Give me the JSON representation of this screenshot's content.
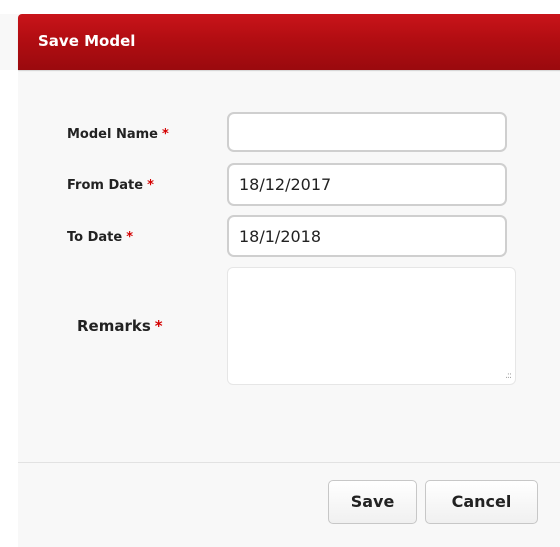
{
  "dialog": {
    "title": "Save Model"
  },
  "form": {
    "model_name": {
      "label": "Model Name",
      "required_marker": "*",
      "value": ""
    },
    "from_date": {
      "label": "From Date",
      "required_marker": "*",
      "value": "18/12/2017"
    },
    "to_date": {
      "label": "To Date",
      "required_marker": "*",
      "value": "18/1/2018"
    },
    "remarks": {
      "label": "Remarks",
      "required_marker": "*",
      "value": ""
    }
  },
  "footer": {
    "save_label": "Save",
    "cancel_label": "Cancel"
  },
  "colors": {
    "header": "#b20d12",
    "required": "#d40000"
  }
}
